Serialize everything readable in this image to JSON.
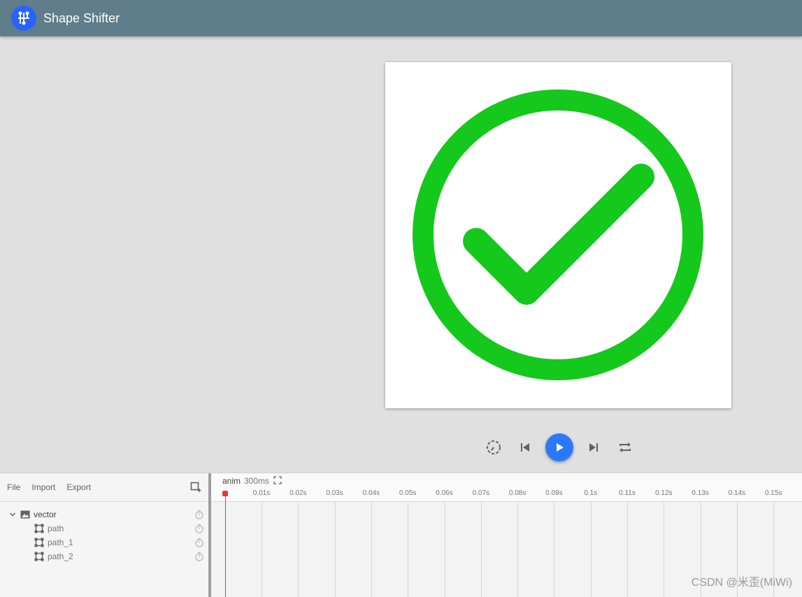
{
  "app": {
    "title": "Shape Shifter"
  },
  "canvas": {
    "stroke_color": "#14c81c"
  },
  "playback": {
    "buttons": [
      "playback-speed-icon",
      "skip-to-start-icon",
      "play-icon",
      "skip-to-end-icon",
      "repeat-icon"
    ],
    "accent": "#2979ff"
  },
  "layers": {
    "menu": {
      "file": "File",
      "import": "Import",
      "export": "Export"
    },
    "items": [
      {
        "label": "vector"
      },
      {
        "label": "path"
      },
      {
        "label": "path_1"
      },
      {
        "label": "path_2"
      }
    ]
  },
  "timeline": {
    "animation_name": "anim",
    "duration": "300ms",
    "ticks": [
      "0.01s",
      "0.02s",
      "0.03s",
      "0.04s",
      "0.05s",
      "0.06s",
      "0.07s",
      "0.08s",
      "0.09s",
      "0.1s",
      "0.11s",
      "0.12s",
      "0.13s",
      "0.14s",
      "0.15s"
    ],
    "playhead_color": "#e53935"
  },
  "watermark": "CSDN @米歪(MiWi)"
}
